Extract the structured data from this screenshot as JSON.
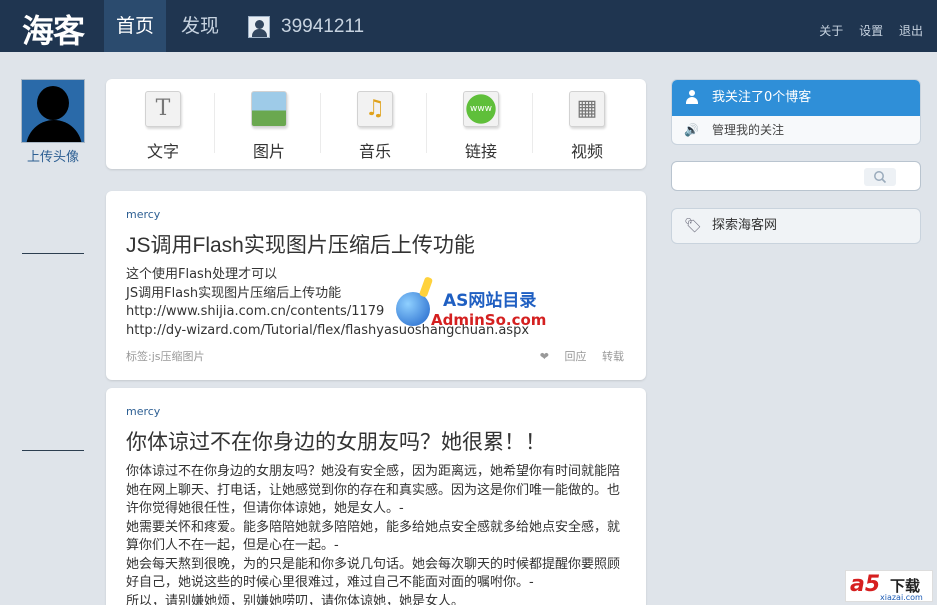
{
  "topbar": {
    "logo": "海客",
    "nav_home": "首页",
    "nav_discover": "发现",
    "user_id": "39941211",
    "about": "关于",
    "settings": "设置",
    "logout": "退出"
  },
  "sidebar_left": {
    "upload_avatar": "上传头像"
  },
  "post_types": [
    {
      "label": "文字",
      "glyph": "T",
      "icon": "text-icon"
    },
    {
      "label": "图片",
      "glyph": "▲",
      "icon": "image-icon"
    },
    {
      "label": "音乐",
      "glyph": "♫",
      "icon": "music-icon"
    },
    {
      "label": "链接",
      "glyph": "www",
      "icon": "link-icon"
    },
    {
      "label": "视频",
      "glyph": "▦",
      "icon": "video-icon"
    }
  ],
  "posts": [
    {
      "author": "mercy",
      "title": "JS调用Flash实现图片压缩后上传功能",
      "body": [
        "这个使用Flash处理才可以",
        "JS调用Flash实现图片压缩后上传功能",
        "http://www.shijia.com.cn/contents/1179",
        "http://dy-wizard.com/Tutorial/flex/flashyasuoshangchuan.aspx"
      ],
      "tags": "标签:js压缩图片",
      "like": "❤",
      "reply": "回应",
      "repost": "转载"
    },
    {
      "author": "mercy",
      "title": "你体谅过不在你身边的女朋友吗？她很累！！",
      "body": [
        "你体谅过不在你身边的女朋友吗？她没有安全感，因为距离远，她希望你有时间就能陪她在网上聊天、打电话，让她感觉到你的存在和真实感。因为这是你们唯一能做的。也许你觉得她很任性，但请你体谅她，她是女人。-",
        "她需要关怀和疼爱。能多陪陪她就多陪陪她，能多给她点安全感就多给她点安全感，就算你们人不在一起，但是心在一起。-",
        "她会每天熬到很晚，为的只是能和你多说几句话。她会每次聊天的时候都提醒你要照顾好自己，她说这些的时候心里很难过，难过自己不能面对面的嘱咐你。-",
        "所以，请别嫌她烦，别嫌她唠叨，请你体谅她，她是女人。"
      ]
    }
  ],
  "sidebar_right": {
    "following": "我关注了0个博客",
    "manage_following": "管理我的关注",
    "search_placeholder": "",
    "explore": "探索海客网"
  },
  "watermarks": {
    "as_cn": "AS网站目录",
    "as_domain": "AdminSo.com",
    "a5_logo": "a5",
    "a5_label": "下载",
    "a5_site": "xiazai.com"
  },
  "colors": {
    "topbar": "#1f3550",
    "accent": "#2f8fd8",
    "link": "#2d5f93",
    "background": "#dfe4ea"
  }
}
